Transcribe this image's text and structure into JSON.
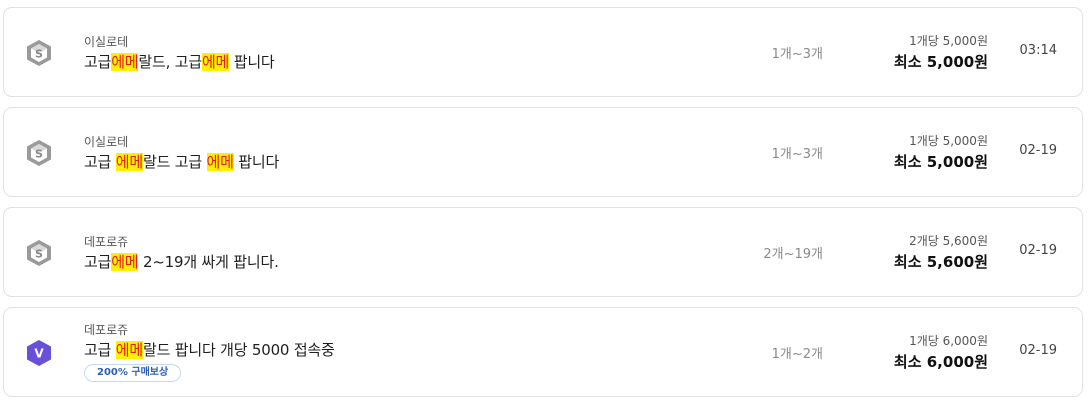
{
  "listings": [
    {
      "badge_icon": "s-coin-hexagon-icon",
      "seller": "이실로테",
      "title_parts": [
        "고급",
        "에메",
        "랄드, 고급",
        "에메",
        " 팝니다"
      ],
      "quantity": "1개~3개",
      "unit_price": "1개당 5,000원",
      "min_price": "최소 5,000원",
      "time": "03:14"
    },
    {
      "badge_icon": "s-coin-hexagon-icon",
      "seller": "이실로테",
      "title_parts": [
        "고급 ",
        "에메",
        "랄드 고급 ",
        "에메",
        " 팝니다"
      ],
      "quantity": "1개~3개",
      "unit_price": "1개당 5,000원",
      "min_price": "최소 5,000원",
      "time": "02-19"
    },
    {
      "badge_icon": "s-coin-hexagon-icon",
      "seller": "데포로쥬",
      "title_parts": [
        "고급",
        "에메",
        " 2~19개 싸게 팝니다."
      ],
      "quantity": "2개~19개",
      "unit_price": "2개당 5,600원",
      "min_price": "최소 5,600원",
      "time": "02-19"
    },
    {
      "badge_icon": "v-verified-hexagon-icon",
      "badge_letter": "V",
      "seller": "데포로쥬",
      "title_parts": [
        "고급 ",
        "에메",
        "랄드 팝니다 개당 5000 접속중"
      ],
      "tag": "200% 구매보상",
      "quantity": "1개~2개",
      "unit_price": "1개당 6,000원",
      "min_price": "최소 6,000원",
      "time": "02-19"
    }
  ],
  "colors": {
    "highlight_bg": "#fff000",
    "highlight_text": "#e02020",
    "s_badge": "#9a9a9a",
    "v_badge": "#6a4fd8",
    "tag_text": "#2d5fb8"
  }
}
